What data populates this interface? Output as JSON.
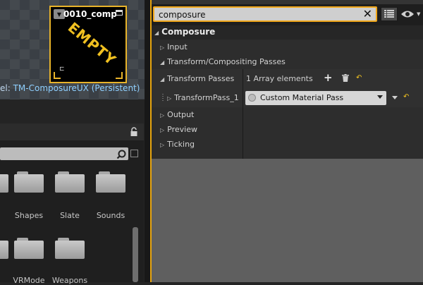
{
  "viewport": {
    "card_title": "0010_comp",
    "card_status": "EMPTY",
    "level_prefix": "el:",
    "level_name": "TM-ComposureUX (Persistent)"
  },
  "content_browser": {
    "folders_row1": [
      "er",
      "Shapes",
      "Slate",
      "Sounds"
    ],
    "folders_row2": [
      "",
      "",
      "VRMode",
      "Weapons"
    ]
  },
  "details": {
    "search": {
      "value": "composure",
      "clear_icon": "✕"
    },
    "category": "Composure",
    "rows": {
      "input": "Input",
      "transform_compositing": "Transform/Compositing Passes",
      "transform_passes": "Transform Passes",
      "array_count": "1 Array elements",
      "transform_pass_1": "TransformPass_1",
      "material_pass": "Custom Material Pass",
      "output": "Output",
      "preview": "Preview",
      "ticking": "Ticking"
    },
    "icons": {
      "expanded": "◢",
      "collapsed": "▷",
      "add": "+",
      "reset": "↶"
    }
  },
  "colors": {
    "accent": "#e8a60f",
    "reset_yellow": "#f2c21f",
    "link_blue": "#8fd0ff"
  }
}
